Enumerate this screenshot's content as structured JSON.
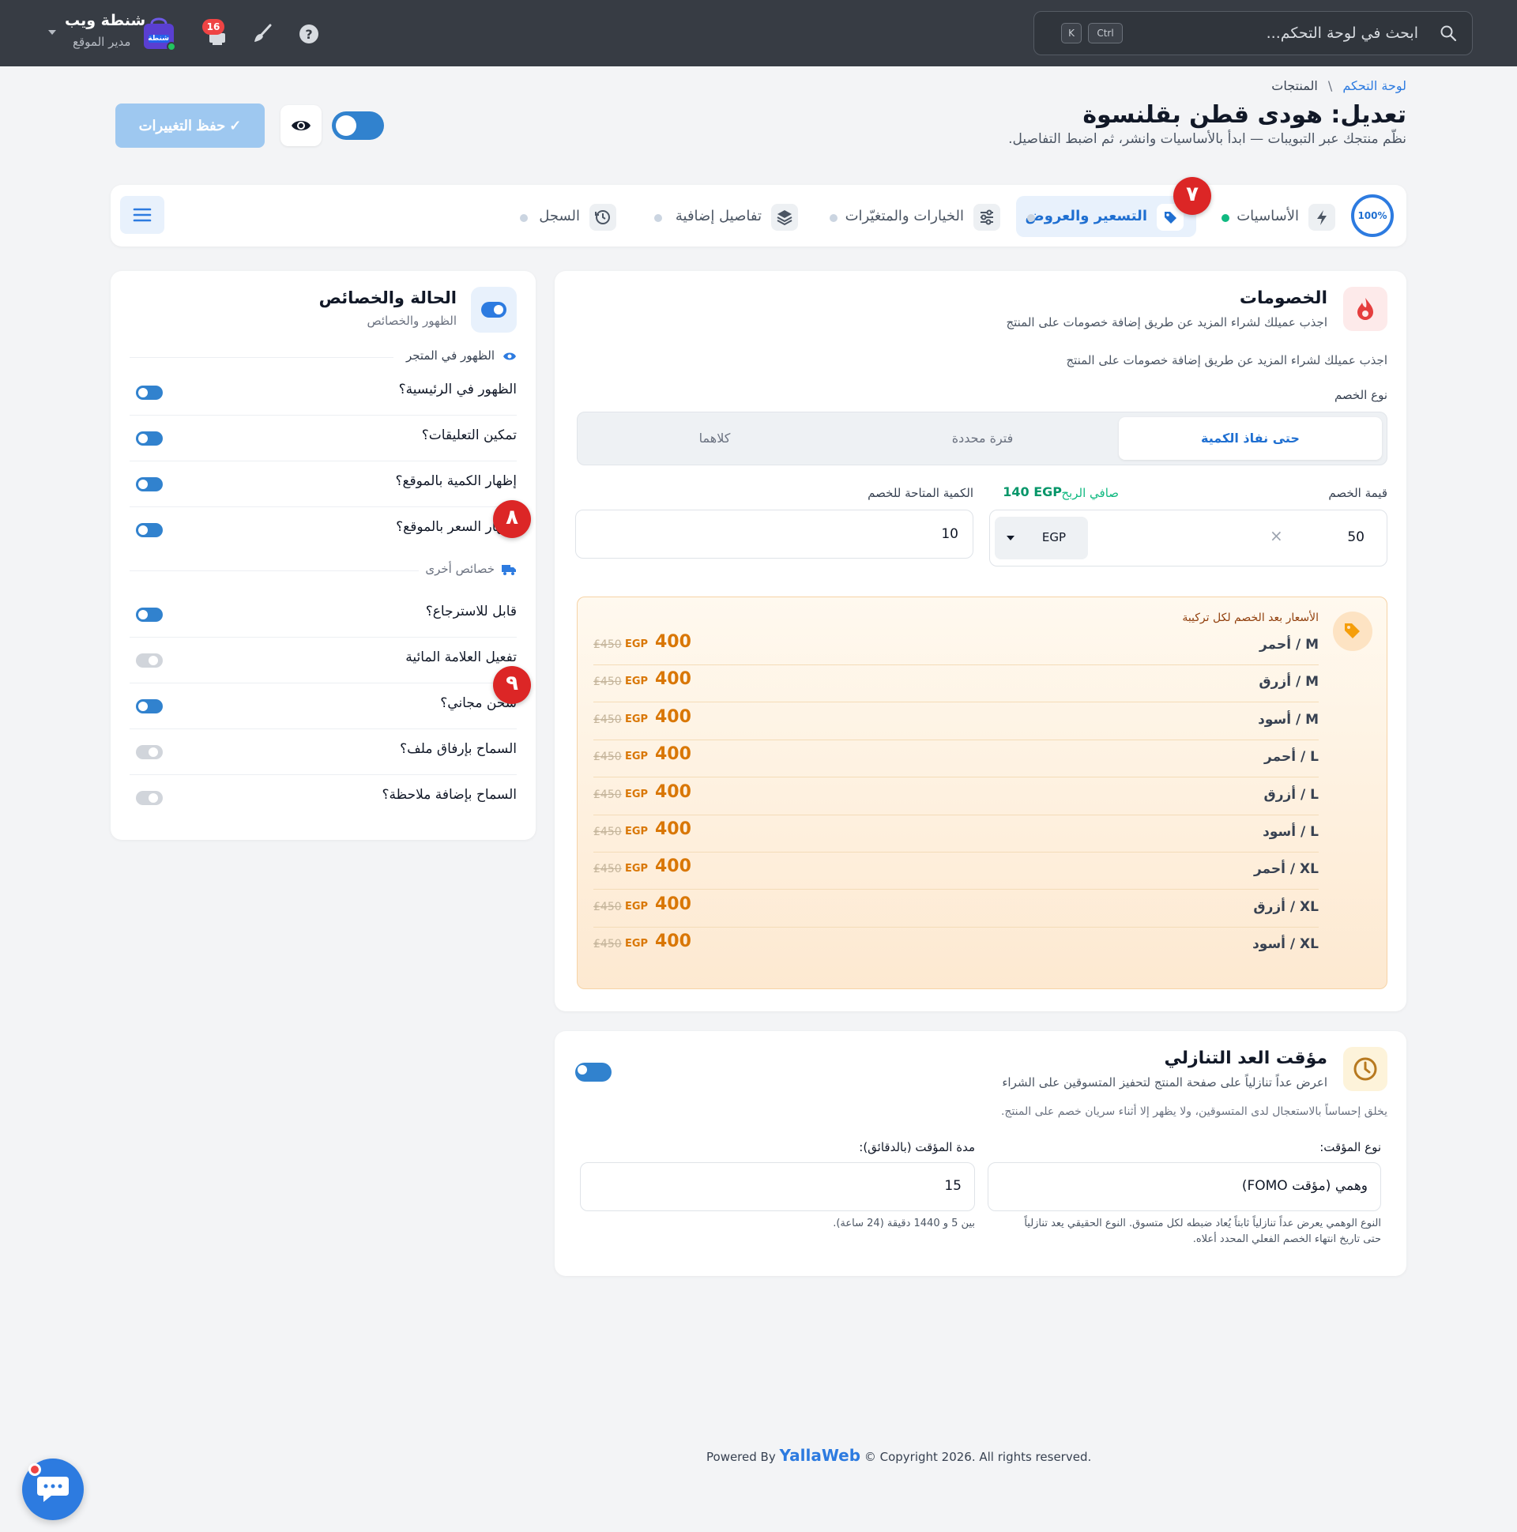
{
  "topbar": {
    "search_placeholder": "ابحث في لوحة التحكم...",
    "kbd_ctrl": "Ctrl",
    "kbd_k": "K",
    "notif_count": "16",
    "user_name": "شنطة ويب",
    "user_role": "مدير الموقع",
    "logo_text": "شنطة"
  },
  "breadcrumb": {
    "home": "لوحة التحكم",
    "sep": "\\",
    "current": "المنتجات"
  },
  "page": {
    "title": "تعديل: هودى قطن بقلنسوة",
    "subtitle": "نظّم منتجك عبر التبويبات — ابدأ بالأساسيات وانشر، ثم اضبط التفاصيل.",
    "save_label": "حفظ التغييرات"
  },
  "tabs": {
    "progress": "100%",
    "items": [
      {
        "label": "الأساسيات"
      },
      {
        "label": "التسعير والعروض"
      },
      {
        "label": "الخيارات والمتغيّرات"
      },
      {
        "label": "تفاصيل إضافية"
      },
      {
        "label": "السجل"
      }
    ]
  },
  "markers": [
    "٧",
    "٨",
    "٩"
  ],
  "discounts": {
    "title": "الخصومات",
    "subtitle": "اجذب عميلك لشراء المزيد عن طريق إضافة خصومات على المنتج",
    "desc": "اجذب عميلك لشراء المزيد عن طريق إضافة خصومات على المنتج",
    "type_label": "نوع الخصم",
    "type_options": [
      "حتى نفاذ الكمية",
      "فترة محددة",
      "كلاهما"
    ],
    "value_label": "قيمة الخصم",
    "value": "50",
    "currency": "EGP",
    "clear": "×",
    "net_profit_label": "صافي الربح",
    "net_profit": "140 EGP",
    "qty_label": "الكمية المتاحة للخصم",
    "qty": "10",
    "prices_title": "الأسعار بعد الخصم لكل تركيبة",
    "price_rows": [
      {
        "variant": "M / أحمر",
        "new": "400",
        "cur": "EGP",
        "old": "450"
      },
      {
        "variant": "M / أزرق",
        "new": "400",
        "cur": "EGP",
        "old": "450"
      },
      {
        "variant": "M / أسود",
        "new": "400",
        "cur": "EGP",
        "old": "450"
      },
      {
        "variant": "L / أحمر",
        "new": "400",
        "cur": "EGP",
        "old": "450"
      },
      {
        "variant": "L / أزرق",
        "new": "400",
        "cur": "EGP",
        "old": "450"
      },
      {
        "variant": "L / أسود",
        "new": "400",
        "cur": "EGP",
        "old": "450"
      },
      {
        "variant": "XL / أحمر",
        "new": "400",
        "cur": "EGP",
        "old": "450"
      },
      {
        "variant": "XL / أزرق",
        "new": "400",
        "cur": "EGP",
        "old": "450"
      },
      {
        "variant": "XL / أسود",
        "new": "400",
        "cur": "EGP",
        "old": "450"
      }
    ]
  },
  "countdown": {
    "title": "مؤقت العد التنازلي",
    "subtitle": "اعرض عداً تنازلياً على صفحة المنتج لتحفيز المتسوقين على الشراء",
    "desc": "يخلق إحساساً بالاستعجال لدى المتسوقين، ولا يظهر إلا أثناء سريان خصم على المنتج.",
    "type_label": "نوع المؤقت:",
    "type_value": "وهمي (مؤقت FOMO)",
    "type_help_1": "النوع الوهمي يعرض عداً تنازلياً ثابتاً يُعاد ضبطه لكل متسوق. النوع الحقيقي يعد تنازلياً",
    "type_help_2": "حتى تاريخ انتهاء الخصم الفعلي المحدد أعلاه.",
    "duration_label": "مدة المؤقت (بالدقائق):",
    "duration_value": "15",
    "duration_help": "بين 5 و 1440 دقيقة (24 ساعة)."
  },
  "status": {
    "title": "الحالة والخصائص",
    "subtitle": "الظهور والخصائص",
    "section1": "الظهور في المتجر",
    "section2": "خصائص أخرى",
    "items": [
      {
        "label": "الظهور في الرئيسية؟",
        "on": true
      },
      {
        "label": "تمكين التعليقات؟",
        "on": true
      },
      {
        "label": "إظهار الكمية بالموقع؟",
        "on": true
      },
      {
        "label": "إظهار السعر بالموقع؟",
        "on": true
      },
      {
        "label": "قابل للاسترجاع؟",
        "on": true
      },
      {
        "label": "تفعيل العلامة المائية",
        "on": false
      },
      {
        "label": "شحن مجاني؟",
        "on": true
      },
      {
        "label": "السماح بإرفاق ملف؟",
        "on": false
      },
      {
        "label": "السماح بإضافة ملاحظة؟",
        "on": false
      }
    ]
  },
  "footer": {
    "powered": "Powered By ",
    "brand": "YallaWeb",
    "copyright": " © Copyright 2026. All rights reserved."
  }
}
